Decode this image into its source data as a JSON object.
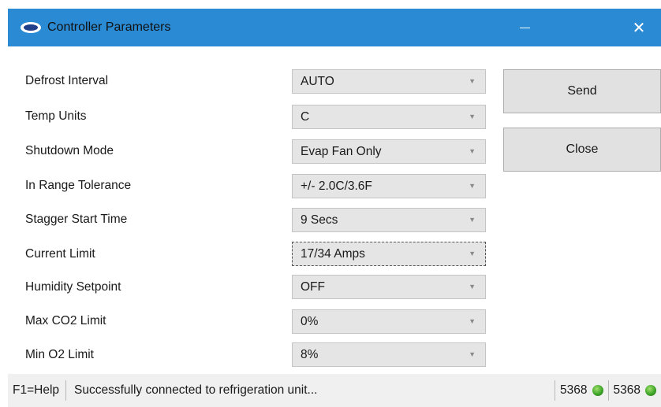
{
  "window": {
    "title": "Controller Parameters",
    "minimize_glyph": "—",
    "close_glyph": "✕"
  },
  "params": [
    {
      "label": "Defrost Interval",
      "value": "AUTO"
    },
    {
      "label": "Temp Units",
      "value": "C"
    },
    {
      "label": "Shutdown Mode",
      "value": "Evap Fan Only"
    },
    {
      "label": "In Range Tolerance",
      "value": "+/- 2.0C/3.6F"
    },
    {
      "label": "Stagger Start Time",
      "value": "9 Secs"
    },
    {
      "label": "Current Limit",
      "value": "17/34 Amps"
    },
    {
      "label": "Humidity Setpoint",
      "value": "OFF"
    },
    {
      "label": "Max CO2 Limit",
      "value": "0%"
    },
    {
      "label": "Min O2 Limit",
      "value": "8%"
    }
  ],
  "buttons": {
    "send": "Send",
    "close": "Close"
  },
  "status": {
    "help": "F1=Help",
    "message": "Successfully connected to refrigeration unit...",
    "count1": "5368",
    "count2": "5368",
    "led_color": "#3fa52a"
  },
  "icons": {
    "chevron": "chevron-down-icon",
    "app": "carrier-logo-icon"
  }
}
